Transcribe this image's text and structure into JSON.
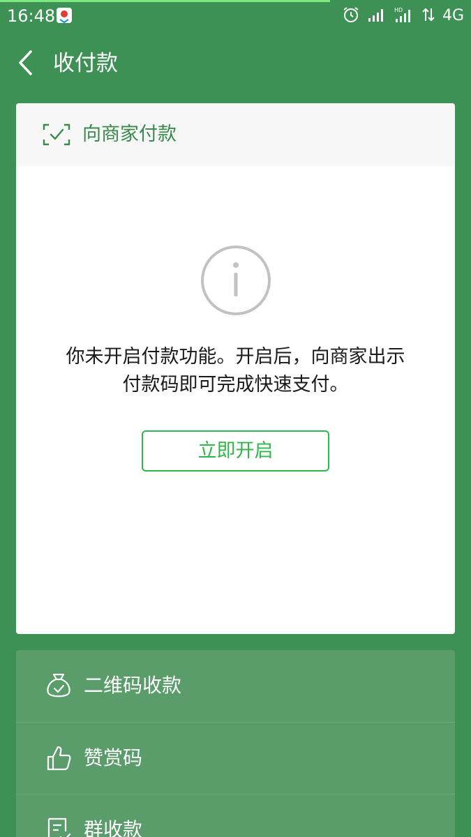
{
  "status_bar": {
    "time": "16:48",
    "network": "4G",
    "progress": 0.7
  },
  "header": {
    "title": "收付款",
    "back_icon": "chevron-left-icon"
  },
  "card": {
    "title": "向商家付款",
    "title_icon": "scan-check-icon",
    "notice_icon": "info-circle-icon",
    "notice_line1": "你未开启付款功能。开启后，向商家出示",
    "notice_line2": "付款码即可完成快速支付。",
    "enable_button": "立即开启"
  },
  "menu": {
    "items": [
      {
        "label": "二维码收款",
        "icon": "money-bag-icon"
      },
      {
        "label": "赞赏码",
        "icon": "thumbs-up-icon"
      },
      {
        "label": "群收款",
        "icon": "group-receipt-icon"
      }
    ]
  },
  "colors": {
    "background": "#3e9155",
    "accent": "#2fb84a",
    "card_title": "#3a8a4e",
    "menu_panel": "#5a9c6a"
  }
}
